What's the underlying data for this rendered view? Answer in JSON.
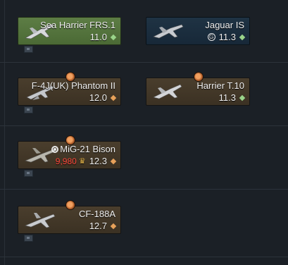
{
  "vehicles": [
    {
      "name": "Sea Harrier FRS.1",
      "br": "11.0",
      "status": "researched",
      "br_diamond": "green"
    },
    {
      "name": "Jaguar IS",
      "br": "11.3",
      "status": "owned",
      "br_diamond": "green",
      "br_prefix_icon": "gold-coin-icon",
      "br_prefix_symbol": "G"
    },
    {
      "name": "F-4J(UK) Phantom II",
      "br": "12.0",
      "status": "available",
      "br_diamond": "orange"
    },
    {
      "name": "Harrier T.10",
      "br": "11.3",
      "status": "available",
      "br_diamond": "green"
    },
    {
      "name": "MiG-21 Bison",
      "br": "12.3",
      "status": "available",
      "br_diamond": "orange",
      "name_icon": "target-icon",
      "research_cost": "9,980",
      "cost_icon": "eagle-icon"
    },
    {
      "name": "CF-188A",
      "br": "12.7",
      "status": "available",
      "br_diamond": "orange"
    }
  ],
  "colors": {
    "background": "#1b2026",
    "researched": "#55753f",
    "owned": "#1c2f40",
    "available": "#433828",
    "cost": "#ff4a3c"
  }
}
